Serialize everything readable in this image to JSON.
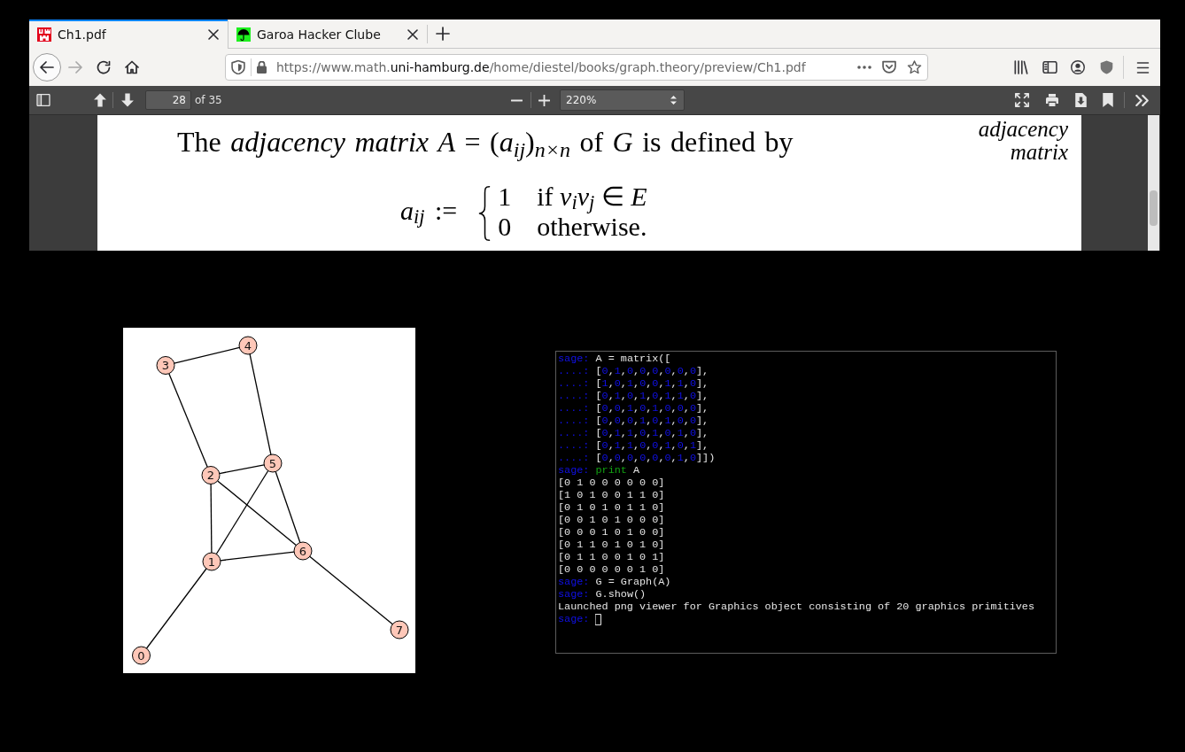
{
  "browser": {
    "tabs": [
      {
        "title": "Ch1.pdf",
        "selected": true
      },
      {
        "title": "Garoa Hacker Clube",
        "selected": false
      }
    ],
    "nav_buttons": [
      {
        "kind": "back",
        "disabled": false
      },
      {
        "kind": "forward",
        "disabled": true
      },
      {
        "kind": "reload",
        "disabled": false
      },
      {
        "kind": "home",
        "disabled": false
      }
    ],
    "url": {
      "origin_start": "https://www.math.",
      "domain": "uni-hamburg.de",
      "path": "/home/diestel/books/graph.theory/preview/Ch1.pdf"
    }
  },
  "pdf_viewer": {
    "page_number": "28",
    "page_count": "of 35",
    "zoom": "220%"
  },
  "pdf_page": {
    "sentence": "The *adjacency matrix* *A* = (*a*$_{ij}$)$_{n×n}$ of *G* is defined by",
    "margin_note": "adjacency matrix",
    "equation": {
      "lhs": "*a*$_{ij}$ :=",
      "cases": [
        {
          "value": "1",
          "condition": "if *v*$_{i}$*v*$_{j}$ ∈ *E*"
        },
        {
          "value": "0",
          "condition": "otherwise."
        }
      ]
    }
  },
  "graph_viewer": {
    "nodes": [
      {
        "label": "0"
      },
      {
        "label": "1"
      },
      {
        "label": "2"
      },
      {
        "label": "3"
      },
      {
        "label": "4"
      },
      {
        "label": "5"
      },
      {
        "label": "6"
      },
      {
        "label": "7"
      }
    ]
  },
  "terminal": {
    "lines": [
      {
        "spans": [
          {
            "kind": "prompt",
            "text": "sage:"
          },
          {
            "kind": "plain",
            "text": " A = matrix(["
          }
        ]
      },
      {
        "spans": [
          {
            "kind": "prompt",
            "text": "....:"
          },
          {
            "kind": "plain",
            "text": " ["
          },
          {
            "kind": "number",
            "text": "0"
          },
          {
            "kind": "plain",
            "text": ","
          },
          {
            "kind": "number",
            "text": "1"
          },
          {
            "kind": "plain",
            "text": ","
          },
          {
            "kind": "number",
            "text": "0"
          },
          {
            "kind": "plain",
            "text": ","
          },
          {
            "kind": "number",
            "text": "0"
          },
          {
            "kind": "plain",
            "text": ","
          },
          {
            "kind": "number",
            "text": "0"
          },
          {
            "kind": "plain",
            "text": ","
          },
          {
            "kind": "number",
            "text": "0"
          },
          {
            "kind": "plain",
            "text": ","
          },
          {
            "kind": "number",
            "text": "0"
          },
          {
            "kind": "plain",
            "text": ","
          },
          {
            "kind": "number",
            "text": "0"
          },
          {
            "kind": "plain",
            "text": "],"
          }
        ]
      },
      {
        "spans": [
          {
            "kind": "prompt",
            "text": "....:"
          },
          {
            "kind": "plain",
            "text": " ["
          },
          {
            "kind": "number",
            "text": "1"
          },
          {
            "kind": "plain",
            "text": ","
          },
          {
            "kind": "number",
            "text": "0"
          },
          {
            "kind": "plain",
            "text": ","
          },
          {
            "kind": "number",
            "text": "1"
          },
          {
            "kind": "plain",
            "text": ","
          },
          {
            "kind": "number",
            "text": "0"
          },
          {
            "kind": "plain",
            "text": ","
          },
          {
            "kind": "number",
            "text": "0"
          },
          {
            "kind": "plain",
            "text": ","
          },
          {
            "kind": "number",
            "text": "1"
          },
          {
            "kind": "plain",
            "text": ","
          },
          {
            "kind": "number",
            "text": "1"
          },
          {
            "kind": "plain",
            "text": ","
          },
          {
            "kind": "number",
            "text": "0"
          },
          {
            "kind": "plain",
            "text": "],"
          }
        ]
      },
      {
        "spans": [
          {
            "kind": "prompt",
            "text": "....:"
          },
          {
            "kind": "plain",
            "text": " ["
          },
          {
            "kind": "number",
            "text": "0"
          },
          {
            "kind": "plain",
            "text": ","
          },
          {
            "kind": "number",
            "text": "1"
          },
          {
            "kind": "plain",
            "text": ","
          },
          {
            "kind": "number",
            "text": "0"
          },
          {
            "kind": "plain",
            "text": ","
          },
          {
            "kind": "number",
            "text": "1"
          },
          {
            "kind": "plain",
            "text": ","
          },
          {
            "kind": "number",
            "text": "0"
          },
          {
            "kind": "plain",
            "text": ","
          },
          {
            "kind": "number",
            "text": "1"
          },
          {
            "kind": "plain",
            "text": ","
          },
          {
            "kind": "number",
            "text": "1"
          },
          {
            "kind": "plain",
            "text": ","
          },
          {
            "kind": "number",
            "text": "0"
          },
          {
            "kind": "plain",
            "text": "],"
          }
        ]
      },
      {
        "spans": [
          {
            "kind": "prompt",
            "text": "....:"
          },
          {
            "kind": "plain",
            "text": " ["
          },
          {
            "kind": "number",
            "text": "0"
          },
          {
            "kind": "plain",
            "text": ","
          },
          {
            "kind": "number",
            "text": "0"
          },
          {
            "kind": "plain",
            "text": ","
          },
          {
            "kind": "number",
            "text": "1"
          },
          {
            "kind": "plain",
            "text": ","
          },
          {
            "kind": "number",
            "text": "0"
          },
          {
            "kind": "plain",
            "text": ","
          },
          {
            "kind": "number",
            "text": "1"
          },
          {
            "kind": "plain",
            "text": ","
          },
          {
            "kind": "number",
            "text": "0"
          },
          {
            "kind": "plain",
            "text": ","
          },
          {
            "kind": "number",
            "text": "0"
          },
          {
            "kind": "plain",
            "text": ","
          },
          {
            "kind": "number",
            "text": "0"
          },
          {
            "kind": "plain",
            "text": "],"
          }
        ]
      },
      {
        "spans": [
          {
            "kind": "prompt",
            "text": "....:"
          },
          {
            "kind": "plain",
            "text": " ["
          },
          {
            "kind": "number",
            "text": "0"
          },
          {
            "kind": "plain",
            "text": ","
          },
          {
            "kind": "number",
            "text": "0"
          },
          {
            "kind": "plain",
            "text": ","
          },
          {
            "kind": "number",
            "text": "0"
          },
          {
            "kind": "plain",
            "text": ","
          },
          {
            "kind": "number",
            "text": "1"
          },
          {
            "kind": "plain",
            "text": ","
          },
          {
            "kind": "number",
            "text": "0"
          },
          {
            "kind": "plain",
            "text": ","
          },
          {
            "kind": "number",
            "text": "1"
          },
          {
            "kind": "plain",
            "text": ","
          },
          {
            "kind": "number",
            "text": "0"
          },
          {
            "kind": "plain",
            "text": ","
          },
          {
            "kind": "number",
            "text": "0"
          },
          {
            "kind": "plain",
            "text": "],"
          }
        ]
      },
      {
        "spans": [
          {
            "kind": "prompt",
            "text": "....:"
          },
          {
            "kind": "plain",
            "text": " ["
          },
          {
            "kind": "number",
            "text": "0"
          },
          {
            "kind": "plain",
            "text": ","
          },
          {
            "kind": "number",
            "text": "1"
          },
          {
            "kind": "plain",
            "text": ","
          },
          {
            "kind": "number",
            "text": "1"
          },
          {
            "kind": "plain",
            "text": ","
          },
          {
            "kind": "number",
            "text": "0"
          },
          {
            "kind": "plain",
            "text": ","
          },
          {
            "kind": "number",
            "text": "1"
          },
          {
            "kind": "plain",
            "text": ","
          },
          {
            "kind": "number",
            "text": "0"
          },
          {
            "kind": "plain",
            "text": ","
          },
          {
            "kind": "number",
            "text": "1"
          },
          {
            "kind": "plain",
            "text": ","
          },
          {
            "kind": "number",
            "text": "0"
          },
          {
            "kind": "plain",
            "text": "],"
          }
        ]
      },
      {
        "spans": [
          {
            "kind": "prompt",
            "text": "....:"
          },
          {
            "kind": "plain",
            "text": " ["
          },
          {
            "kind": "number",
            "text": "0"
          },
          {
            "kind": "plain",
            "text": ","
          },
          {
            "kind": "number",
            "text": "1"
          },
          {
            "kind": "plain",
            "text": ","
          },
          {
            "kind": "number",
            "text": "1"
          },
          {
            "kind": "plain",
            "text": ","
          },
          {
            "kind": "number",
            "text": "0"
          },
          {
            "kind": "plain",
            "text": ","
          },
          {
            "kind": "number",
            "text": "0"
          },
          {
            "kind": "plain",
            "text": ","
          },
          {
            "kind": "number",
            "text": "1"
          },
          {
            "kind": "plain",
            "text": ","
          },
          {
            "kind": "number",
            "text": "0"
          },
          {
            "kind": "plain",
            "text": ","
          },
          {
            "kind": "number",
            "text": "1"
          },
          {
            "kind": "plain",
            "text": "],"
          }
        ]
      },
      {
        "spans": [
          {
            "kind": "prompt",
            "text": "....:"
          },
          {
            "kind": "plain",
            "text": " ["
          },
          {
            "kind": "number",
            "text": "0"
          },
          {
            "kind": "plain",
            "text": ","
          },
          {
            "kind": "number",
            "text": "0"
          },
          {
            "kind": "plain",
            "text": ","
          },
          {
            "kind": "number",
            "text": "0"
          },
          {
            "kind": "plain",
            "text": ","
          },
          {
            "kind": "number",
            "text": "0"
          },
          {
            "kind": "plain",
            "text": ","
          },
          {
            "kind": "number",
            "text": "0"
          },
          {
            "kind": "plain",
            "text": ","
          },
          {
            "kind": "number",
            "text": "0"
          },
          {
            "kind": "plain",
            "text": ","
          },
          {
            "kind": "number",
            "text": "1"
          },
          {
            "kind": "plain",
            "text": ","
          },
          {
            "kind": "number",
            "text": "0"
          },
          {
            "kind": "plain",
            "text": "]])"
          }
        ]
      },
      {
        "spans": [
          {
            "kind": "prompt",
            "text": "sage:"
          },
          {
            "kind": "keyword",
            "text": " print"
          },
          {
            "kind": "plain",
            "text": " A"
          }
        ]
      },
      {
        "spans": [
          {
            "kind": "plain",
            "text": "[0 1 0 0 0 0 0 0]"
          }
        ]
      },
      {
        "spans": [
          {
            "kind": "plain",
            "text": "[1 0 1 0 0 1 1 0]"
          }
        ]
      },
      {
        "spans": [
          {
            "kind": "plain",
            "text": "[0 1 0 1 0 1 1 0]"
          }
        ]
      },
      {
        "spans": [
          {
            "kind": "plain",
            "text": "[0 0 1 0 1 0 0 0]"
          }
        ]
      },
      {
        "spans": [
          {
            "kind": "plain",
            "text": "[0 0 0 1 0 1 0 0]"
          }
        ]
      },
      {
        "spans": [
          {
            "kind": "plain",
            "text": "[0 1 1 0 1 0 1 0]"
          }
        ]
      },
      {
        "spans": [
          {
            "kind": "plain",
            "text": "[0 1 1 0 0 1 0 1]"
          }
        ]
      },
      {
        "spans": [
          {
            "kind": "plain",
            "text": "[0 0 0 0 0 0 1 0]"
          }
        ]
      },
      {
        "spans": [
          {
            "kind": "prompt",
            "text": "sage:"
          },
          {
            "kind": "plain",
            "text": " G = Graph(A)"
          }
        ]
      },
      {
        "spans": [
          {
            "kind": "prompt",
            "text": "sage:"
          },
          {
            "kind": "plain",
            "text": " G.show()"
          }
        ]
      },
      {
        "spans": [
          {
            "kind": "plain",
            "text": "Launched png viewer for Graphics object consisting of 20 graphics primitives"
          }
        ]
      },
      {
        "spans": [
          {
            "kind": "prompt",
            "text": "sage:"
          }
        ]
      }
    ],
    "cursor": true
  }
}
